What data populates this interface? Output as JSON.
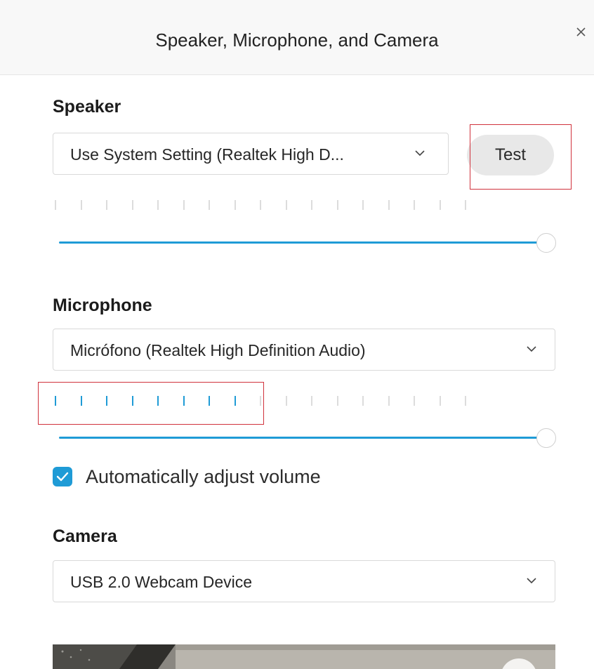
{
  "dialog": {
    "title": "Speaker, Microphone, and Camera",
    "close_icon": "close-icon"
  },
  "speaker": {
    "heading": "Speaker",
    "selected_device": "Use System Setting (Realtek High D...",
    "test_label": "Test",
    "level_meter": {
      "active_ticks": 0,
      "total_ticks": 17
    },
    "volume_level": 1.0
  },
  "microphone": {
    "heading": "Microphone",
    "selected_device": "Micrófono (Realtek High Definition Audio)",
    "level_meter": {
      "active_ticks": 8,
      "total_ticks": 17
    },
    "volume_level": 1.0,
    "auto_adjust_label": "Automatically adjust volume",
    "auto_adjust_checked": true
  },
  "camera": {
    "heading": "Camera",
    "selected_device": "USB 2.0 Webcam Device"
  },
  "colors": {
    "accent": "#1f9bd6",
    "highlight": "#d0323c",
    "header_bg": "#f8f8f8"
  },
  "icons": {
    "close": "close-icon",
    "chevron": "chevron-down-icon",
    "checkmark": "checkmark-icon"
  }
}
